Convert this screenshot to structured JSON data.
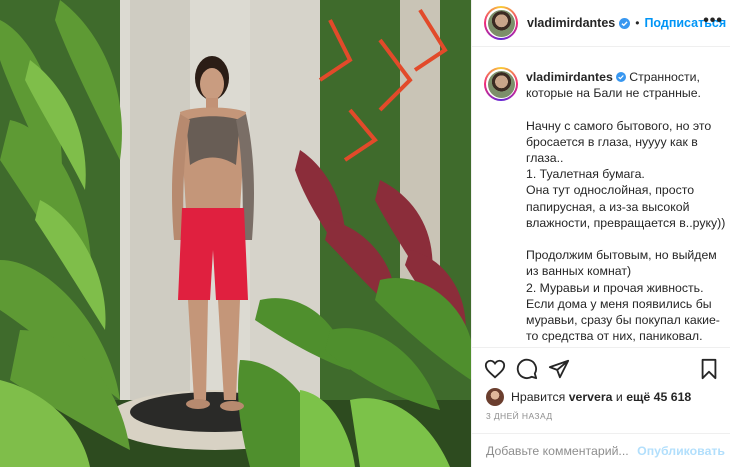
{
  "post": {
    "username": "vladimirdantes",
    "follow_label": "Подписаться",
    "separator": "•",
    "more_label": "•••",
    "caption_username": "vladimirdantes",
    "caption_body": " Странности, которые на Бали не странные.\n\nНачну с самого бытового, но это бросается в глаза, нуууу как в глаза..\n1. Туалетная бумага.\nОна тут однослойная, просто папирусная, а из-за высокой влажности, превращается в..руку))\n\nПродолжим бытовым, но выйдем из ванных комнат)\n2. Муравьи и прочая живность.\nЕсли дома у меня появились бы муравьи, сразу бы покупал какие-то средства от них, паниковал.\nГекконы...Мне иногда кажется, что они арендодатели местные.\nПаучки, жучки и т.д. Всё кажется",
    "likes": {
      "prefix": "Нравится ",
      "user": "ververa",
      "middle": " и ",
      "count": "ещё 45 618"
    },
    "date": "3 ДНЕЙ НАЗАД"
  },
  "comment": {
    "placeholder": "Добавьте комментарий...",
    "publish_label": "Опубликовать"
  },
  "colors": {
    "accent": "#0095f6",
    "accent_disabled": "#b2dffc",
    "muted": "#8e8e8e",
    "border": "#efefef"
  },
  "icons": {
    "like": "heart-icon",
    "comment": "comment-bubble-icon",
    "share": "paper-plane-icon",
    "save": "bookmark-icon",
    "verified": "verified-badge-icon",
    "more": "more-options-icon"
  }
}
